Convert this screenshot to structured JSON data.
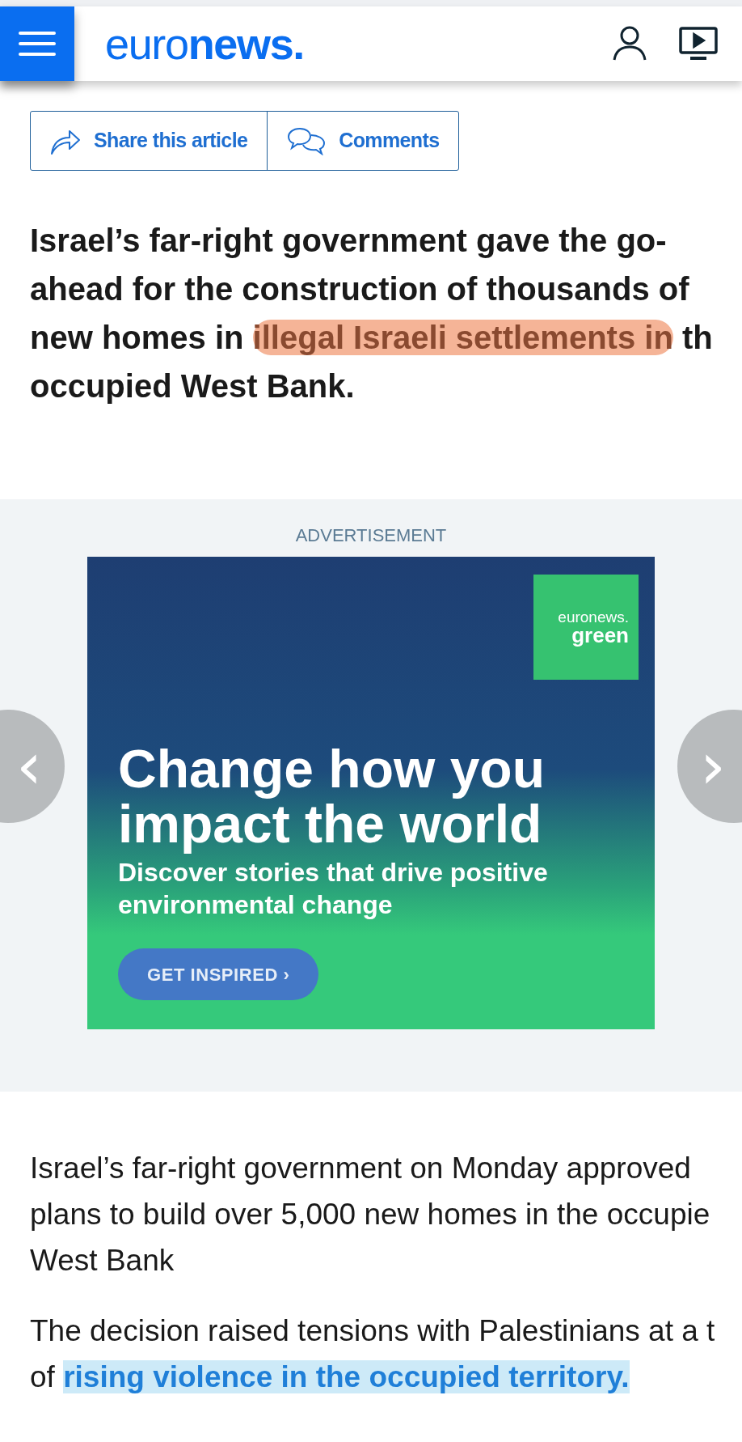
{
  "header": {
    "logo": {
      "light": "euro",
      "bold": "news."
    }
  },
  "share_bar": {
    "buttons": [
      {
        "kind": "share",
        "label": "Share this article"
      },
      {
        "kind": "comments",
        "label": "Comments"
      }
    ]
  },
  "headline": {
    "lines": [
      [
        {
          "text": "Israel’s far-right government gave the go-",
          "highlighted": false
        }
      ],
      [
        {
          "text": "ahead for the construction of thousands of",
          "highlighted": false
        }
      ],
      [
        {
          "text": "new homes in ",
          "highlighted": false
        },
        {
          "text": "illegal Israeli settlements in",
          "highlighted": true
        },
        {
          "text": " th",
          "highlighted": false
        }
      ],
      [
        {
          "text": "occupied West Bank.",
          "highlighted": false
        }
      ]
    ]
  },
  "advertisement": {
    "label": "ADVERTISEMENT",
    "brand": {
      "line_1": "euronews.",
      "line_2": "green"
    },
    "title_lines": [
      "Change how you",
      "impact the world"
    ],
    "subtitle_lines": [
      "Discover stories that drive positive",
      "environmental change"
    ],
    "button": "GET INSPIRED ›"
  },
  "carousel": {
    "previous": "‹",
    "next": "›"
  },
  "body": [
    {
      "lines": [
        [
          {
            "text": "Israel’s far-right government on Monday approved",
            "link": false
          }
        ],
        [
          {
            "text": "plans to build over 5,000 new homes in the occupie",
            "link": false
          }
        ],
        [
          {
            "text": "West Bank",
            "link": false
          }
        ]
      ]
    },
    {
      "lines": [
        [
          {
            "text": "The decision raised tensions with Palestinians at a t",
            "link": false
          }
        ],
        [
          {
            "text": "of ",
            "link": false
          },
          {
            "text": "rising violence in the occupied territory.",
            "link": true
          }
        ]
      ]
    }
  ]
}
